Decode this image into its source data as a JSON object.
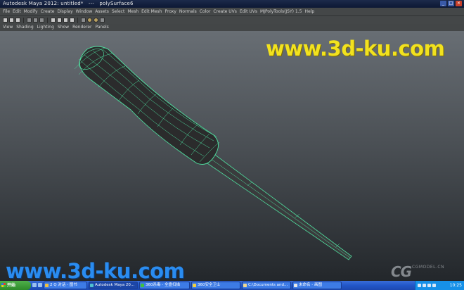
{
  "window": {
    "title": "Autodesk Maya 2012: untitled*   ---   polySurface6",
    "buttons": {
      "minimize": "_",
      "maximize": "□",
      "close": "×"
    }
  },
  "menubar": {
    "items": [
      "File",
      "Edit",
      "Modify",
      "Create",
      "Display",
      "Window",
      "Assets",
      "Select",
      "Mesh",
      "Edit Mesh",
      "Proxy",
      "Normals",
      "Color",
      "Create UVs",
      "Edit UVs",
      "MJPolyTools(JSY) 1.5",
      "Help"
    ]
  },
  "statusline": {
    "icons": [
      "new-scene-icon",
      "open-scene-icon",
      "save-scene-icon",
      "select-hierarchy-icon",
      "select-object-icon",
      "select-component-icon",
      "snap-grid-icon",
      "snap-curve-icon",
      "snap-point-icon",
      "snap-plane-icon",
      "construction-history-icon",
      "render-icon",
      "ipr-render-icon",
      "render-settings-icon"
    ]
  },
  "panel_menu": {
    "items": [
      "View",
      "Shading",
      "Lighting",
      "Show",
      "Renderer",
      "Panels"
    ]
  },
  "viewport": {
    "watermark_top": "www.3d-ku.com",
    "watermark_bottom": "www.3d-ku.com",
    "logo_big": "CG",
    "logo_small": "CGMODEL.CN",
    "wire_color": "#4fe0a0",
    "handle_color": "#2b2b2c",
    "shaft_color": "#3a3b3d"
  },
  "taskbar": {
    "start_label": "开始",
    "tasks": [
      {
        "label": "2 Q 对话 - 图书"
      },
      {
        "label": "Autodesk Maya 20..."
      },
      {
        "label": "360杀毒 - 全盘扫描"
      },
      {
        "label": "360安全卫士"
      },
      {
        "label": "C:\\Documents and..."
      },
      {
        "label": "未命名 - 画图"
      }
    ],
    "clock": "10:25"
  },
  "colors": {
    "titlebar": "#0c1834",
    "menubar": "#444748",
    "taskbar": "#2256c8",
    "watermark_top": "#f2e21e",
    "watermark_bottom": "#2a8cf0"
  }
}
